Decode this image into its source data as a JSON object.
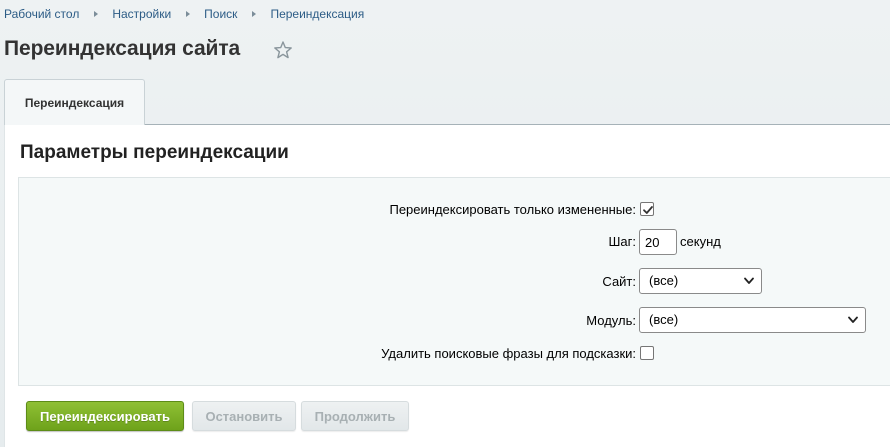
{
  "breadcrumb": {
    "items": [
      "Рабочий стол",
      "Настройки",
      "Поиск",
      "Переиндексация"
    ]
  },
  "page": {
    "title": "Переиндексация сайта",
    "favorite_icon": "star-outline-icon"
  },
  "tabs": [
    {
      "label": "Переиндексация",
      "active": true
    }
  ],
  "panel": {
    "heading": "Параметры переиндексации"
  },
  "form": {
    "only_changed": {
      "label": "Переиндексировать только измененные:",
      "checked": true
    },
    "step": {
      "label": "Шаг:",
      "value": "20",
      "unit": "секунд"
    },
    "site": {
      "label": "Сайт:",
      "selected": "(все)"
    },
    "module": {
      "label": "Модуль:",
      "selected": "(все)"
    },
    "delete_phrases": {
      "label": "Удалить поисковые фразы для подсказки:",
      "checked": false
    }
  },
  "buttons": {
    "reindex": "Переиндексировать",
    "stop": "Остановить",
    "continue": "Продолжить"
  },
  "colors": {
    "accent_green": "#7ab02a",
    "link_blue": "#2c5c86"
  }
}
